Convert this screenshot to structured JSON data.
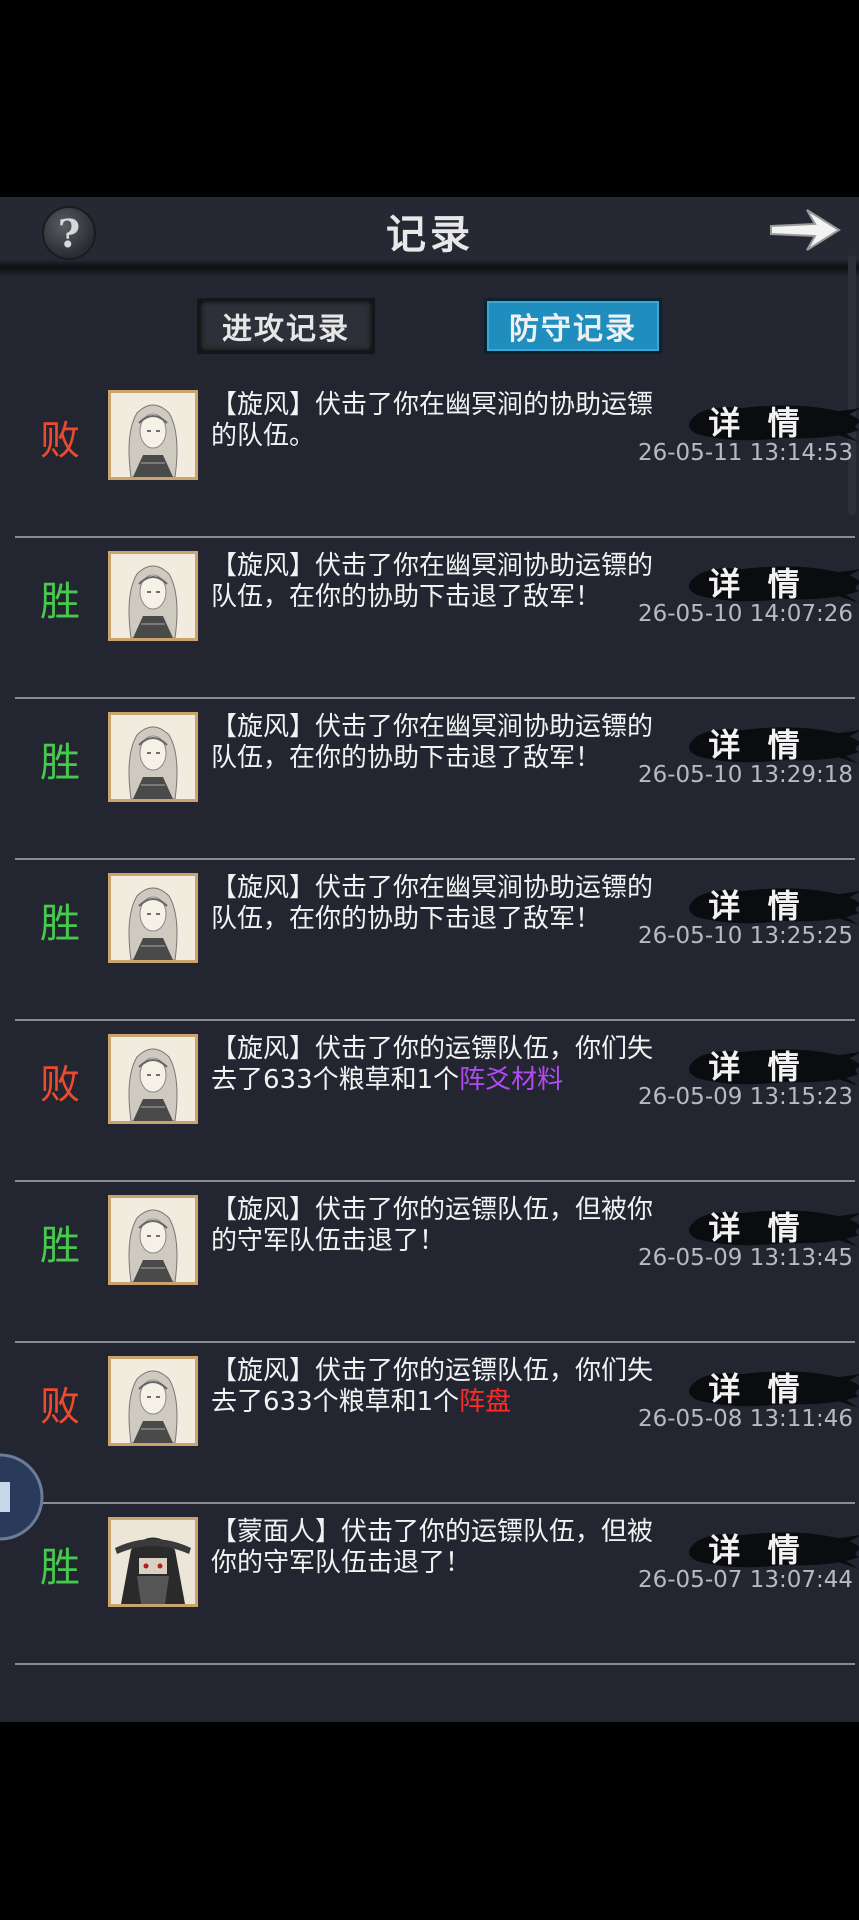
{
  "header": {
    "title": "记录",
    "help_label": "?"
  },
  "tabs": [
    {
      "label": "进攻记录",
      "active": false
    },
    {
      "label": "防守记录",
      "active": true
    }
  ],
  "detail_label": "详 情",
  "records": [
    {
      "result": "败",
      "outcome": "lose",
      "avatar": "longhair-hero",
      "text": "【旋风】伏击了你在幽冥涧的协助运镖的队伍。",
      "extra": "",
      "time": "26-05-11 13:14:53"
    },
    {
      "result": "胜",
      "outcome": "win",
      "avatar": "longhair-hero",
      "text": "【旋风】伏击了你在幽冥涧协助运镖的队伍，在你的协助下击退了敌军！",
      "extra": "",
      "time": "26-05-10 14:07:26"
    },
    {
      "result": "胜",
      "outcome": "win",
      "avatar": "longhair-hero",
      "text": "【旋风】伏击了你在幽冥涧协助运镖的队伍，在你的协助下击退了敌军！",
      "extra": "",
      "time": "26-05-10 13:29:18"
    },
    {
      "result": "胜",
      "outcome": "win",
      "avatar": "longhair-hero",
      "text": "【旋风】伏击了你在幽冥涧协助运镖的队伍，在你的协助下击退了敌军！",
      "extra": "",
      "time": "26-05-10 13:25:25"
    },
    {
      "result": "败",
      "outcome": "lose",
      "avatar": "longhair-hero",
      "text": "【旋风】伏击了你的运镖队伍，你们失去了633个粮草和1个",
      "extra": "阵爻材料",
      "extra_color": "purple",
      "time": "26-05-09 13:15:23"
    },
    {
      "result": "胜",
      "outcome": "win",
      "avatar": "longhair-hero",
      "text": "【旋风】伏击了你的运镖队伍，但被你的守军队伍击退了！",
      "extra": "",
      "time": "26-05-09 13:13:45"
    },
    {
      "result": "败",
      "outcome": "lose",
      "avatar": "longhair-hero",
      "text": "【旋风】伏击了你的运镖队伍，你们失去了633个粮草和1个",
      "extra": "阵盘",
      "extra_color": "red",
      "time": "26-05-08 13:11:46"
    },
    {
      "result": "胜",
      "outcome": "win",
      "avatar": "masked-man",
      "text": "【蒙面人】伏击了你的运镖队伍，但被你的守军队伍击退了！",
      "extra": "",
      "time": "26-05-07 13:07:44"
    }
  ]
}
